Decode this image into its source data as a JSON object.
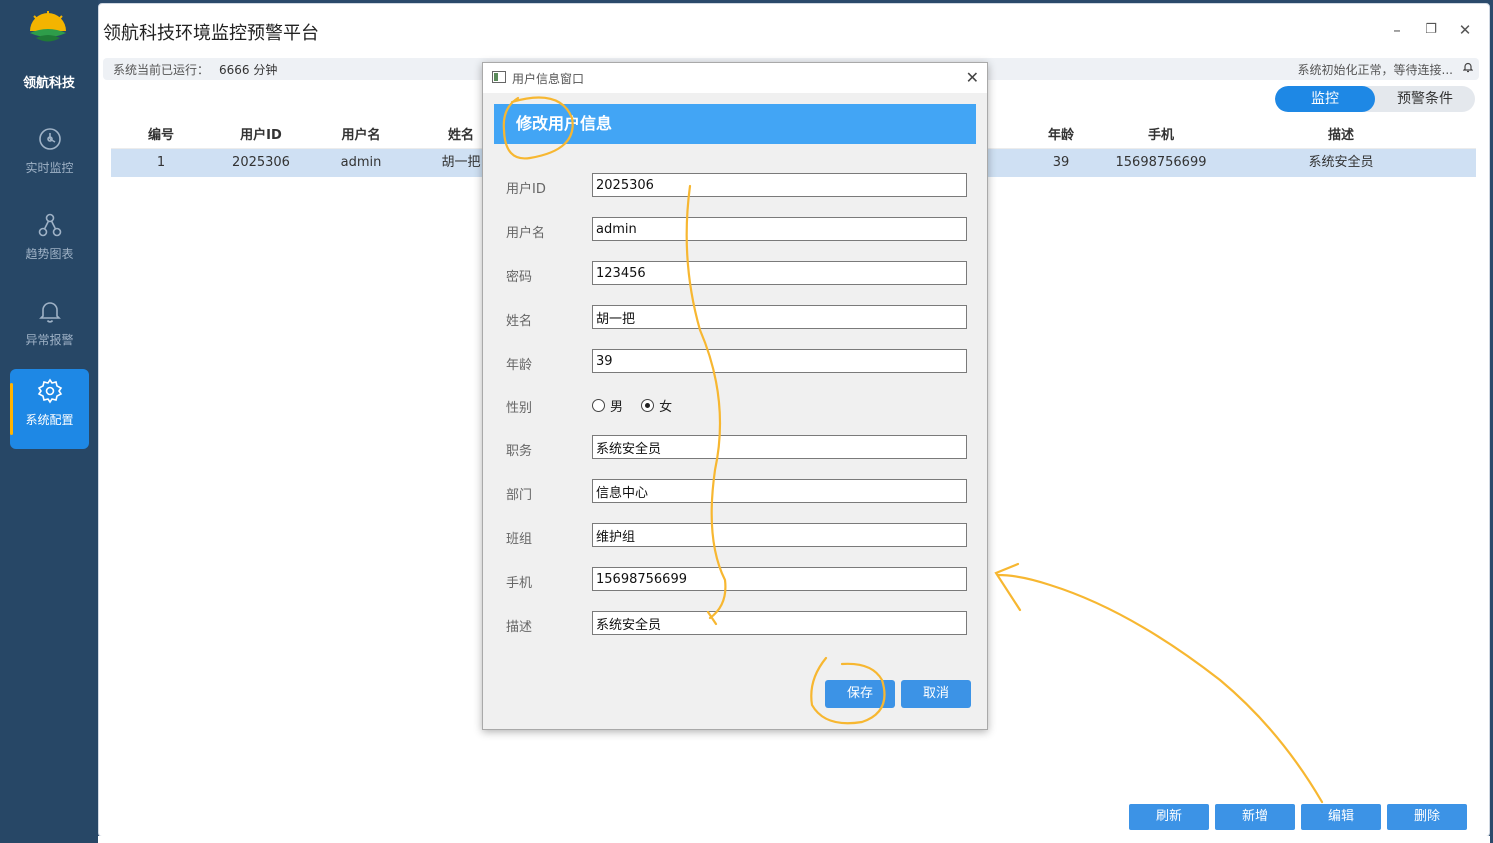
{
  "sidebar": {
    "brand": "领航科技",
    "items": [
      {
        "label": "实时监控",
        "icon": "dashboard-icon"
      },
      {
        "label": "趋势图表",
        "icon": "graph-nodes-icon"
      },
      {
        "label": "异常报警",
        "icon": "bell-icon"
      },
      {
        "label": "系统配置",
        "icon": "gear-icon",
        "active": true
      }
    ]
  },
  "window": {
    "title": "领航科技环境监控预警平台",
    "controls": {
      "minimize": "–",
      "restore": "❐",
      "close": "✕"
    }
  },
  "status": {
    "uptime_label": "系统当前已运行：",
    "uptime_value": "6666 分钟",
    "message": "系统初始化正常，等待连接..."
  },
  "tabs": [
    {
      "label": "监控",
      "active": true
    },
    {
      "label": "预警条件",
      "active": false
    }
  ],
  "table": {
    "headers": [
      "编号",
      "用户ID",
      "用户名",
      "姓名",
      "年龄",
      "手机",
      "描述"
    ],
    "rows": [
      [
        "1",
        "2025306",
        "admin",
        "胡一把",
        "39",
        "15698756699",
        "系统安全员"
      ]
    ]
  },
  "actions": {
    "refresh": "刷新",
    "add": "新增",
    "edit": "编辑",
    "delete": "删除"
  },
  "dialog": {
    "title": "用户信息窗口",
    "header": "修改用户信息",
    "fields": {
      "user_id": {
        "label": "用户ID",
        "value": "2025306"
      },
      "username": {
        "label": "用户名",
        "value": "admin"
      },
      "password": {
        "label": "密码",
        "value": "123456"
      },
      "name": {
        "label": "姓名",
        "value": "胡一把"
      },
      "age": {
        "label": "年龄",
        "value": "39"
      },
      "gender": {
        "label": "性别",
        "options": [
          "男",
          "女"
        ],
        "selected": "女"
      },
      "position": {
        "label": "职务",
        "value": "系统安全员"
      },
      "department": {
        "label": "部门",
        "value": "信息中心"
      },
      "team": {
        "label": "班组",
        "value": "维护组"
      },
      "phone": {
        "label": "手机",
        "value": "15698756699"
      },
      "description": {
        "label": "描述",
        "value": "系统安全员"
      }
    },
    "save": "保存",
    "cancel": "取消"
  },
  "colors": {
    "sidebar_bg": "#274766",
    "accent": "#1e88e5",
    "button": "#3c93e6",
    "dialog_header": "#42a5f5",
    "selected_row": "#cfe0f3",
    "annotation": "#f7b731"
  }
}
